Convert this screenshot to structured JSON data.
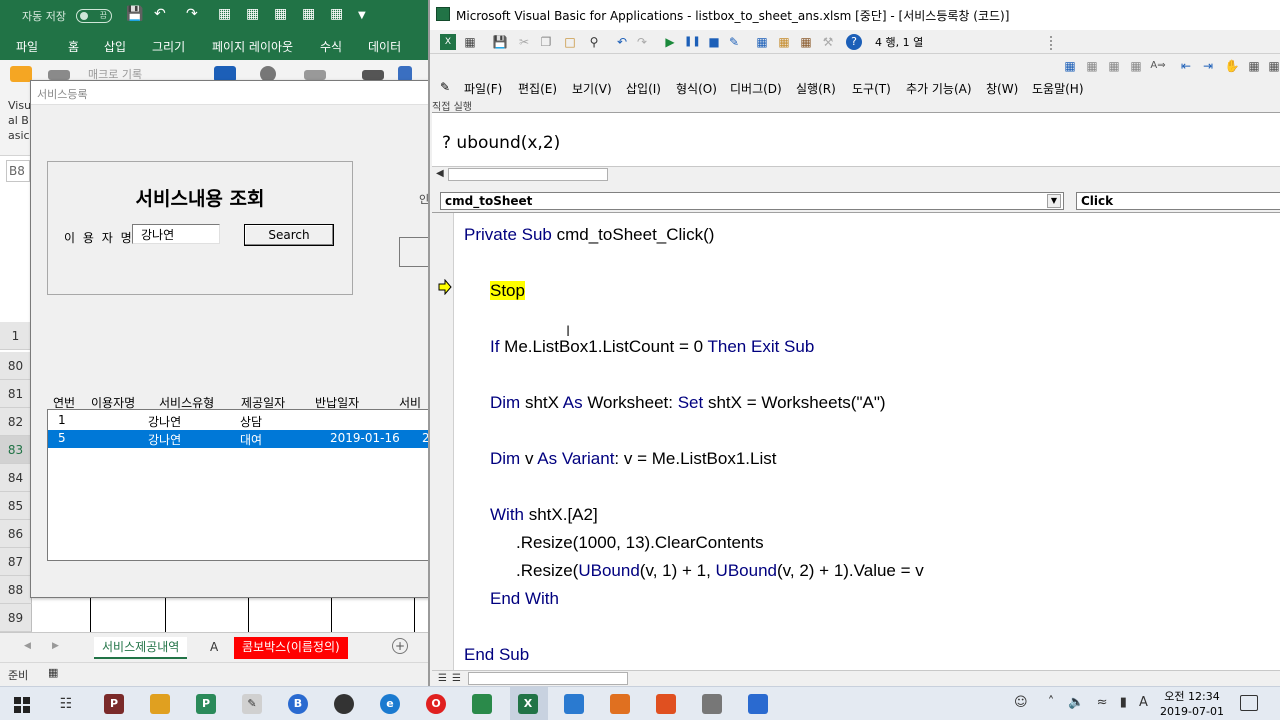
{
  "excel": {
    "autosave_label": "자동 저장",
    "autosave_state": "끔",
    "ribbon_tabs": [
      "파일",
      "홈",
      "삽입",
      "그리기",
      "페이지 레이아웃",
      "수식",
      "데이터"
    ],
    "ribbon_macro_label": "매크로 기록",
    "ribbon_vb_label": "Visual Basic",
    "namebox_value": "B8",
    "row_numbers": [
      "1",
      "80",
      "81",
      "82",
      "83",
      "84",
      "85",
      "86",
      "87",
      "88",
      "89"
    ],
    "sheet_tabs": [
      "서비스제공내역",
      "A",
      "콤보박스(이름정의)"
    ],
    "status_text": "준비"
  },
  "userform": {
    "title": "서비스등록",
    "heading": "서비스내용 조회",
    "user_label": "이 용 자 명",
    "user_value": "강나연",
    "search_label": "Search",
    "partial_button_text": "인",
    "columns": [
      "연번",
      "이용자명",
      "서비스유형",
      "제공일자",
      "반납일자",
      "서비스"
    ],
    "rows": [
      {
        "no": "1",
        "name": "강나연",
        "type": "상담",
        "date": "",
        "return_date": "",
        "extra": ""
      },
      {
        "no": "5",
        "name": "강나연",
        "type": "대여",
        "date": "",
        "return_date": "2019-01-16",
        "extra": "2"
      }
    ],
    "selected_row": 1
  },
  "vbe": {
    "window_title": "Microsoft Visual Basic for Applications - listbox_to_sheet_ans.xlsm [중단] - [서비스등록창 (코드)]",
    "position_text": "4 행, 1 열",
    "menu": [
      "파일(F)",
      "편집(E)",
      "보기(V)",
      "삽입(I)",
      "형식(O)",
      "디버그(D)",
      "실행(R)",
      "도구(T)",
      "추가 기능(A)",
      "창(W)",
      "도움말(H)"
    ],
    "immediate_title": "직접 실행",
    "immediate_text": "? ubound(x,2)",
    "object_dropdown": "cmd_toSheet",
    "procedure_dropdown": "Click",
    "code": {
      "l1_kw": "Private Sub",
      "l1_rest": " cmd_toSheet_Click()",
      "stop": "Stop",
      "l3_kw1": "If",
      "l3_mid": " Me.ListBox1.ListCount = 0 ",
      "l3_kw2": "Then Exit Sub",
      "l4_kw1": "Dim",
      "l4_a": " shtX ",
      "l4_kw2": "As",
      "l4_b": " Worksheet: ",
      "l4_kw3": "Set",
      "l4_c": " shtX = Worksheets(\"A\")",
      "l5_kw1": "Dim",
      "l5_a": " v ",
      "l5_kw2": "As",
      "l5_b": " ",
      "l5_kw3": "Variant",
      "l5_c": ": v = Me.ListBox1.List",
      "l6_kw": "With",
      "l6_rest": " shtX.[A2]",
      "l7": ".Resize(1000, 13).ClearContents",
      "l8_a": ".Resize(",
      "l8_kw1": "UBound",
      "l8_b": "(v, 1) + 1, ",
      "l8_kw2": "UBound",
      "l8_c": "(v, 2) + 1).Value = v",
      "l9": "End With",
      "l10": "End Sub"
    }
  },
  "taskbar": {
    "time": "오전 12:34",
    "date": "2019-07-01",
    "ime": "A"
  },
  "colors": {
    "excel_green": "#217346",
    "vba_keyword": "#00007f",
    "stop_highlight": "#ffff00",
    "listbox_selection": "#0078d7",
    "sheet_tab_red": "#ff0000"
  }
}
